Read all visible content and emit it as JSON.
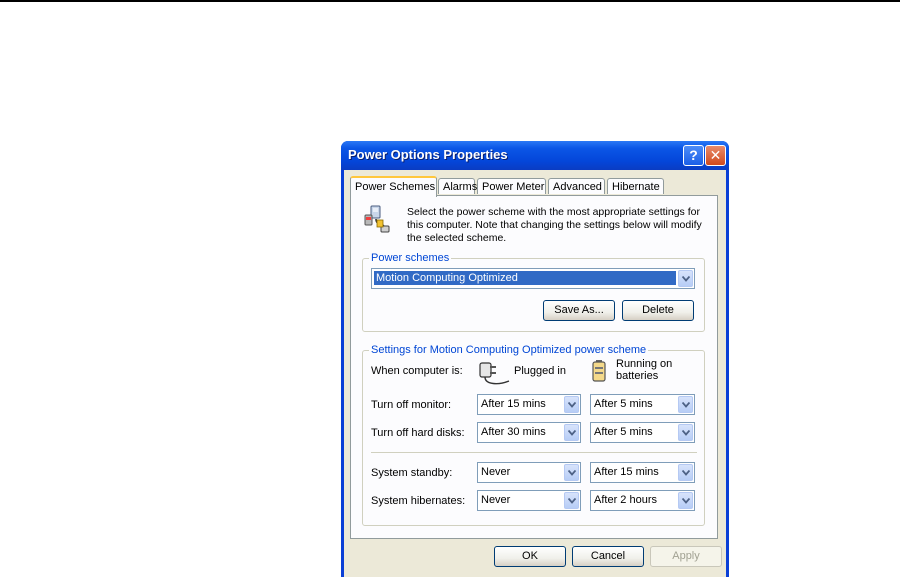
{
  "window": {
    "title": "Power Options Properties",
    "help_glyph": "?",
    "close_glyph": "✕"
  },
  "tabs": [
    {
      "label": "Power Schemes",
      "active": true
    },
    {
      "label": "Alarms"
    },
    {
      "label": "Power Meter"
    },
    {
      "label": "Advanced"
    },
    {
      "label": "Hibernate"
    }
  ],
  "intro": {
    "icon": "power-scheme-icon",
    "text": "Select the power scheme with the most appropriate settings for this computer. Note that changing the settings below will modify the selected scheme."
  },
  "schemes": {
    "group_label": "Power schemes",
    "selected": "Motion Computing Optimized",
    "save_as_label": "Save As...",
    "delete_label": "Delete"
  },
  "settings": {
    "group_label": "Settings for Motion Computing Optimized power scheme",
    "when_label": "When computer is:",
    "plugged_in_label": "Plugged in",
    "batteries_label_line1": "Running on",
    "batteries_label_line2": "batteries",
    "rows": [
      {
        "label": "Turn off monitor:",
        "plugged": "After 15 mins",
        "battery": "After 5 mins"
      },
      {
        "label": "Turn off hard disks:",
        "plugged": "After 30 mins",
        "battery": "After 5 mins"
      },
      {
        "label": "System standby:",
        "plugged": "Never",
        "battery": "After 15 mins"
      },
      {
        "label": "System hibernates:",
        "plugged": "Never",
        "battery": "After 2 hours"
      }
    ]
  },
  "footer": {
    "ok_label": "OK",
    "cancel_label": "Cancel",
    "apply_label": "Apply"
  },
  "colors": {
    "title_bar": "#0b56e6",
    "group_label": "#0046d5",
    "selection": "#316ac5",
    "active_tab_accent": "#ffc73c"
  }
}
